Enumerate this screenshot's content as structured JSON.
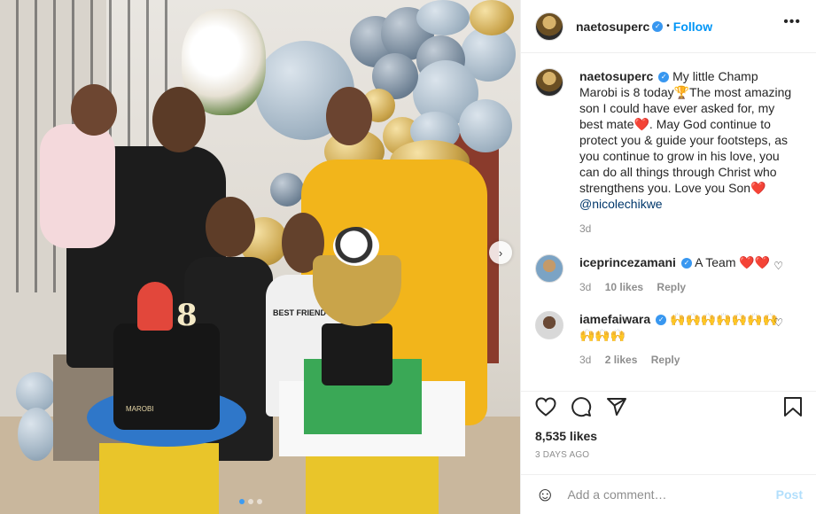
{
  "photo": {
    "cake_number": "8",
    "shirt_text": "BEST FRIEND",
    "cake_text": "MAROBI",
    "carousel_count": 3,
    "carousel_active": 0
  },
  "header": {
    "username": "naetosuperc",
    "follow_label": "Follow",
    "more_icon": "more-icon"
  },
  "caption": {
    "username": "naetosuperc",
    "text_1": "My little Champ Marobi is 8 today",
    "emoji_trophy": "🏆",
    "text_2": "The most amazing son I could have ever asked for, my best mate",
    "emoji_heart": "❤️",
    "text_3": ". May God continue to protect you & guide your footsteps, as you continue to grow in his love, you can do all things through Christ who strengthens you. Love you Son",
    "mention": "@nicolechikwe",
    "time": "3d"
  },
  "comments": [
    {
      "username": "iceprincezamani",
      "text": "A Team ❤️❤️",
      "time": "3d",
      "likes": "10 likes",
      "reply": "Reply"
    },
    {
      "username": "iamefaiwara",
      "text": "🙌🙌🙌🙌🙌🙌🙌🙌🙌🙌",
      "time": "3d",
      "likes": "2 likes",
      "reply": "Reply"
    }
  ],
  "actions": {
    "likes": "8,535 likes",
    "age": "3 DAYS AGO"
  },
  "comment_bar": {
    "placeholder": "Add a comment…",
    "post_label": "Post"
  },
  "colors": {
    "accent": "#0095f6",
    "verified": "#3897f0",
    "post_disabled": "#b2dffc",
    "dress": "#f2b51b"
  }
}
